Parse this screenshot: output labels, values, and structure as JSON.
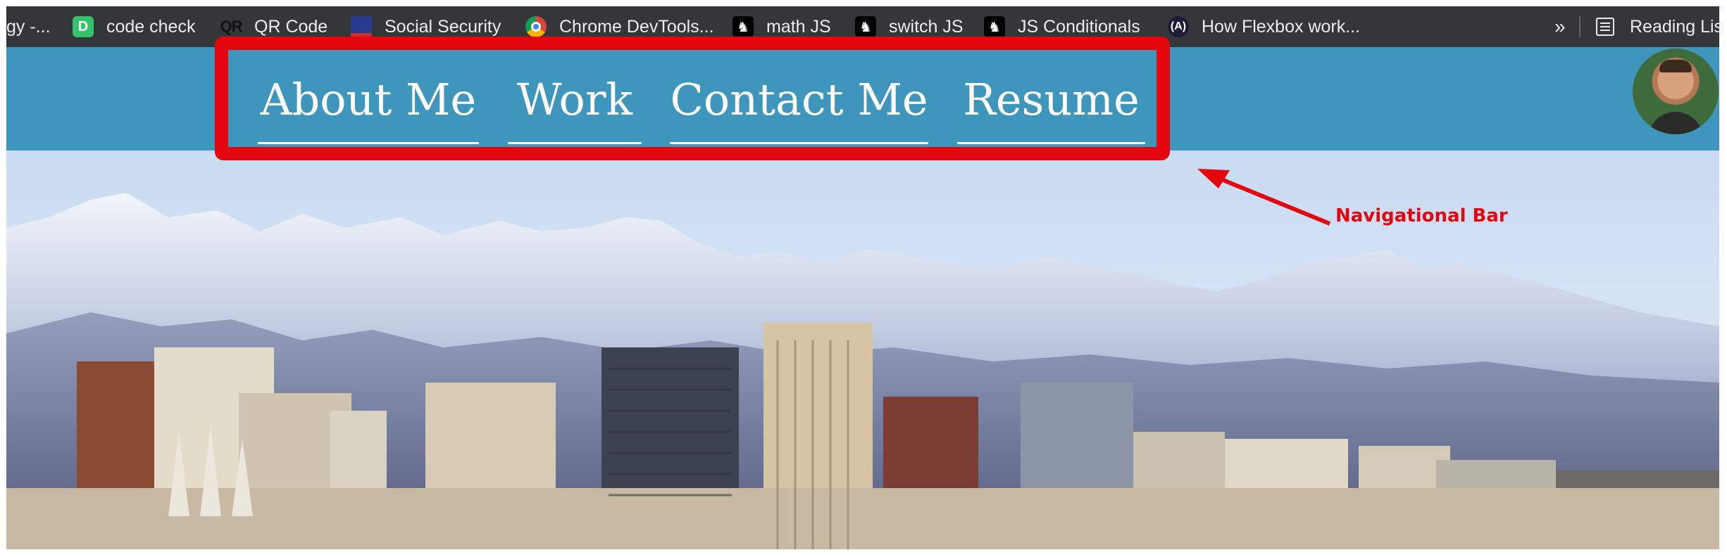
{
  "bookmarks": {
    "items": [
      {
        "label": "gy -...",
        "icon": "truncated"
      },
      {
        "label": "code check",
        "icon": "code-check-icon"
      },
      {
        "label": "QR Code",
        "icon": "qr-icon",
        "icon_text": "QR"
      },
      {
        "label": "Social Security",
        "icon": "flag-icon"
      },
      {
        "label": "Chrome DevTools...",
        "icon": "chrome-icon"
      },
      {
        "label": "math JS",
        "icon": "freecodecamp-icon"
      },
      {
        "label": "switch JS",
        "icon": "freecodecamp-icon"
      },
      {
        "label": "JS Conditionals",
        "icon": "freecodecamp-icon"
      },
      {
        "label": "How Flexbox work...",
        "icon": "flexbox-icon"
      }
    ],
    "overflow": "»",
    "reading_list": "Reading Lis"
  },
  "nav": {
    "items": [
      "About Me",
      "Work",
      "Contact Me",
      "Resume"
    ]
  },
  "annotation": {
    "label": "Navigational Bar",
    "color": "#e4060f"
  },
  "colors": {
    "header_bg": "#3f96bd",
    "bookmarks_bg": "#35363a"
  }
}
